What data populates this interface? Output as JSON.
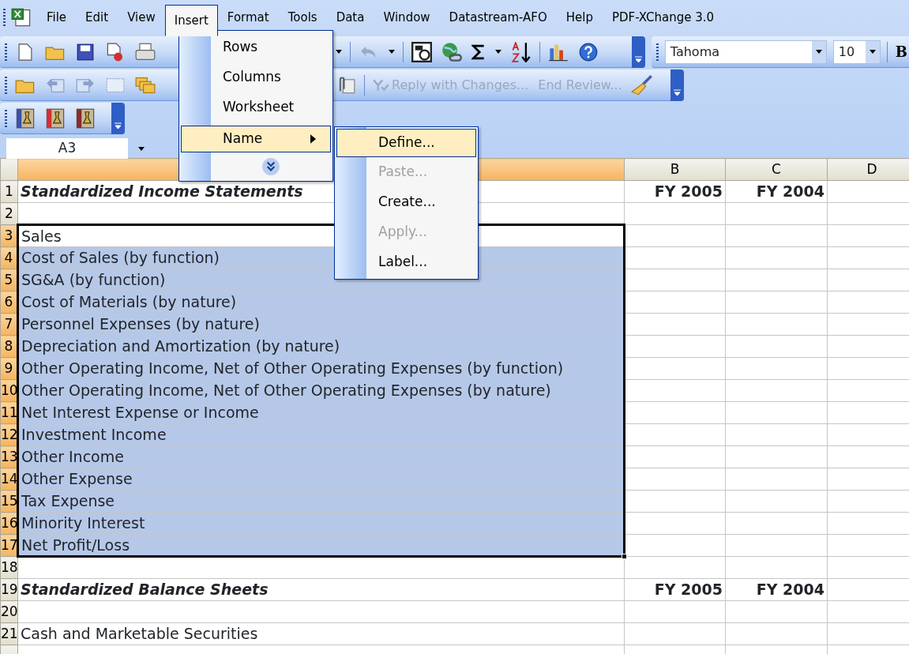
{
  "menu_bar": {
    "items": [
      {
        "label": "File",
        "selected": false
      },
      {
        "label": "Edit",
        "selected": false
      },
      {
        "label": "View",
        "selected": false
      },
      {
        "label": "Insert",
        "selected": true
      },
      {
        "label": "Format",
        "selected": false
      },
      {
        "label": "Tools",
        "selected": false
      },
      {
        "label": "Data",
        "selected": false
      },
      {
        "label": "Window",
        "selected": false
      },
      {
        "label": "Datastream-AFO",
        "selected": false
      },
      {
        "label": "Help",
        "selected": false
      },
      {
        "label": "PDF-XChange 3.0",
        "selected": false
      }
    ]
  },
  "formatting_toolbar": {
    "font": "Tahoma",
    "size": "10",
    "bold_label": "B"
  },
  "reviewing_toolbar": {
    "buttons": [
      {
        "label": "Reply with Changes...",
        "disabled": true
      },
      {
        "label": "End Review...",
        "disabled": true
      }
    ]
  },
  "name_box": {
    "value": "A3"
  },
  "insert_menu": {
    "items": [
      {
        "kind": "item",
        "label": "Rows",
        "selected": false
      },
      {
        "kind": "item",
        "label": "Columns",
        "selected": false
      },
      {
        "kind": "item",
        "label": "Worksheet",
        "selected": false
      },
      {
        "kind": "submenu",
        "label": "Name",
        "selected": true
      },
      {
        "kind": "expand",
        "selected": false
      }
    ]
  },
  "name_submenu": {
    "items": [
      {
        "label": "Define...",
        "selected": true,
        "disabled": false
      },
      {
        "label": "Paste...",
        "selected": false,
        "disabled": true
      },
      {
        "label": "Create...",
        "selected": false,
        "disabled": false
      },
      {
        "label": "Apply...",
        "selected": false,
        "disabled": true
      },
      {
        "label": "Label...",
        "selected": false,
        "disabled": false
      }
    ]
  },
  "sheet": {
    "columns": [
      {
        "selected": true
      },
      {
        "label": "B",
        "selected": false
      },
      {
        "label": "C",
        "selected": false
      },
      {
        "label": "D",
        "selected": false
      }
    ],
    "rows": [
      {
        "number": "1",
        "kind": "heading",
        "selected": false,
        "active": false,
        "a": "Standardized Income Statements",
        "b": "FY 2005",
        "c": "FY 2004"
      },
      {
        "number": "2",
        "kind": "plain",
        "selected": false,
        "active": false
      },
      {
        "number": "3",
        "kind": "plain",
        "selected": true,
        "active": true,
        "a": "Sales"
      },
      {
        "number": "4",
        "kind": "plain",
        "selected": true,
        "active": false,
        "a": "Cost of Sales (by function)"
      },
      {
        "number": "5",
        "kind": "plain",
        "selected": true,
        "active": false,
        "a": "SG&A (by function)"
      },
      {
        "number": "6",
        "kind": "plain",
        "selected": true,
        "active": false,
        "a": "Cost of Materials (by nature)"
      },
      {
        "number": "7",
        "kind": "plain",
        "selected": true,
        "active": false,
        "a": "Personnel Expenses (by nature)"
      },
      {
        "number": "8",
        "kind": "plain",
        "selected": true,
        "active": false,
        "a": "Depreciation and Amortization (by nature)"
      },
      {
        "number": "9",
        "kind": "plain",
        "selected": true,
        "active": false,
        "a": "Other Operating Income, Net of Other Operating Expenses (by function)"
      },
      {
        "number": "10",
        "kind": "plain",
        "selected": true,
        "active": false,
        "a": "Other Operating Income, Net of Other Operating Expenses (by nature)"
      },
      {
        "number": "11",
        "kind": "plain",
        "selected": true,
        "active": false,
        "a": "Net Interest Expense or Income"
      },
      {
        "number": "12",
        "kind": "plain",
        "selected": true,
        "active": false,
        "a": "Investment Income"
      },
      {
        "number": "13",
        "kind": "plain",
        "selected": true,
        "active": false,
        "a": "Other Income"
      },
      {
        "number": "14",
        "kind": "plain",
        "selected": true,
        "active": false,
        "a": "Other Expense"
      },
      {
        "number": "15",
        "kind": "plain",
        "selected": true,
        "active": false,
        "a": "Tax Expense"
      },
      {
        "number": "16",
        "kind": "plain",
        "selected": true,
        "active": false,
        "a": "Minority Interest"
      },
      {
        "number": "17",
        "kind": "plain",
        "selected": true,
        "active": false,
        "a": "Net Profit/Loss"
      },
      {
        "number": "18",
        "kind": "plain",
        "selected": false,
        "active": false
      },
      {
        "number": "19",
        "kind": "heading",
        "selected": false,
        "active": false,
        "a": "Standardized Balance Sheets",
        "b": "FY 2005",
        "c": "FY 2004"
      },
      {
        "number": "20",
        "kind": "plain",
        "selected": false,
        "active": false
      },
      {
        "number": "21",
        "kind": "plain",
        "selected": false,
        "active": false,
        "a": "Cash and Marketable Securities"
      }
    ]
  }
}
